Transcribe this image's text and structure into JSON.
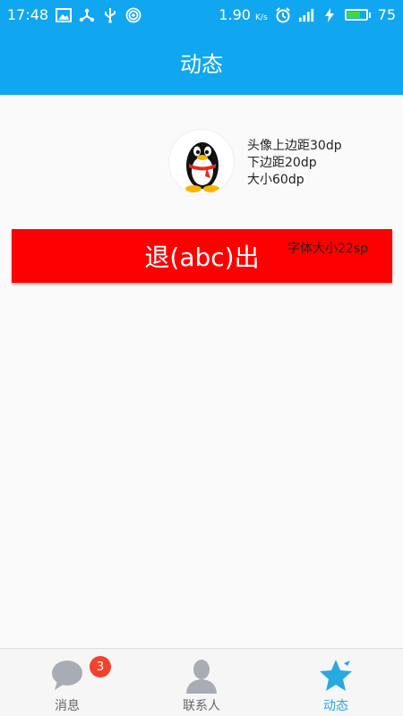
{
  "status_bar": {
    "time": "17:48",
    "speed": "1.90",
    "speed_unit": "K/s",
    "battery_level": "75",
    "battery_fill_fraction": 0.75,
    "icons": [
      "image-icon",
      "usb-share-icon",
      "usb-icon",
      "hotspot-icon",
      "alarm-icon",
      "signal-4g-icon",
      "charging-icon",
      "battery-icon"
    ]
  },
  "header": {
    "title": "动态"
  },
  "profile": {
    "avatar_icon": "qq-penguin-avatar",
    "note_lines": [
      "头像上边距30dp",
      "下边距20dp",
      "大小60dp"
    ]
  },
  "exit_button": {
    "label": "退(abc)出",
    "note": "字体大小22sp",
    "color": "#ff0000"
  },
  "bottom_nav": {
    "items": [
      {
        "label": "消息",
        "icon": "chat-bubble-icon",
        "badge": "3"
      },
      {
        "label": "联系人",
        "icon": "contact-person-icon"
      },
      {
        "label": "动态",
        "icon": "star-icon",
        "active": true
      }
    ]
  },
  "colors": {
    "primary": "#10a7f0",
    "active_tab": "#27a9e1",
    "badge": "#f0432c"
  }
}
